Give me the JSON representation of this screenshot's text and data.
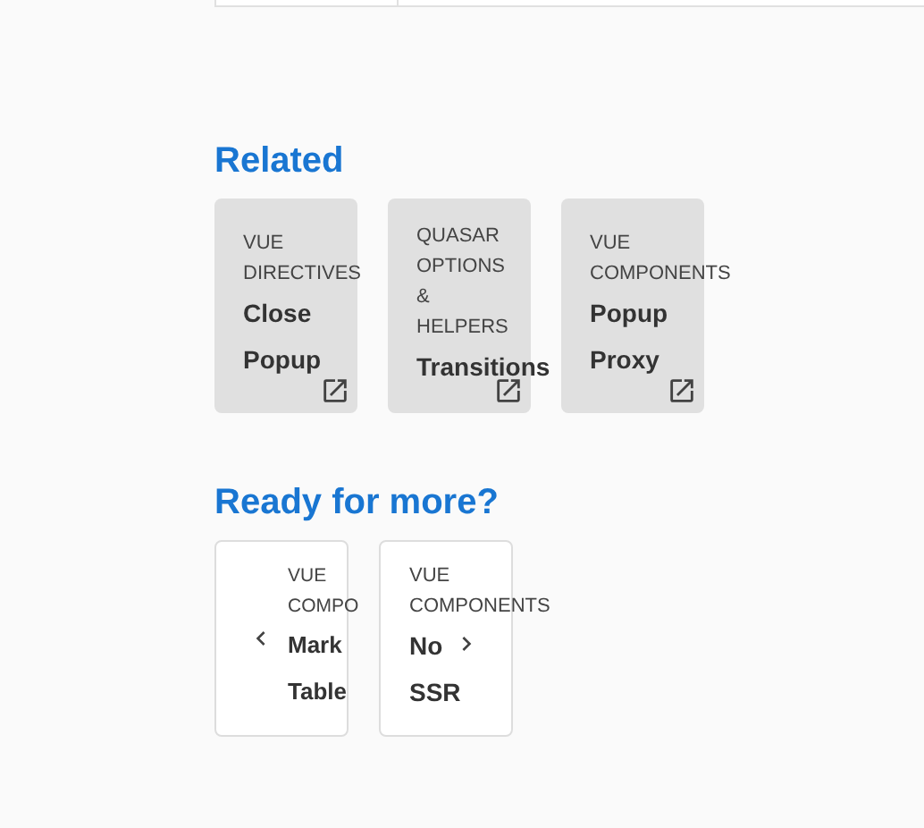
{
  "related": {
    "heading": "Related",
    "cards": [
      {
        "category": "VUE DIRECTIVES",
        "title": "Close Popup"
      },
      {
        "category": "QUASAR OPTIONS & HELPERS",
        "title": "Transitions"
      },
      {
        "category": "VUE COMPONENTS",
        "title": "Popup Proxy"
      }
    ]
  },
  "more": {
    "heading": "Ready for more?",
    "cards": [
      {
        "kind": "prev",
        "category": "VUE COMPO",
        "title": "Mark Table"
      },
      {
        "kind": "next",
        "category": "VUE COMPONENTS",
        "title": "No SSR"
      }
    ]
  }
}
